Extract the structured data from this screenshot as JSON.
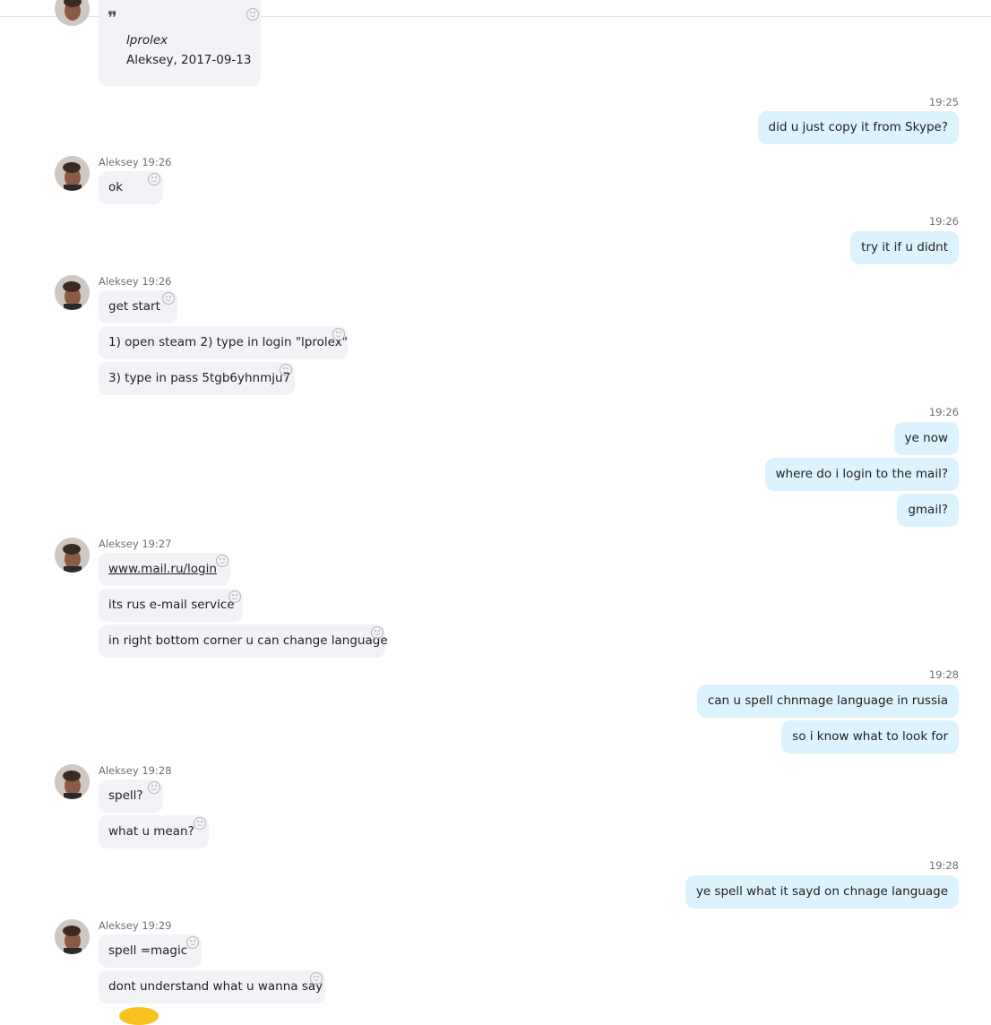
{
  "quote": {
    "author": "lprolex",
    "source": "Aleksey, 2017-09-13"
  },
  "messages": {
    "t1": "19:25",
    "m1": "did u just copy it from Skype?",
    "g1": {
      "sender": "Aleksey",
      "time": "19:26"
    },
    "m2": "ok",
    "t2": "19:26",
    "m3": "try it if u didnt",
    "g2": {
      "sender": "Aleksey",
      "time": "19:26"
    },
    "m4": "get start",
    "m5": "1) open steam 2) type in login \"lprolex\"",
    "m6": "3) type in pass 5tgb6yhnmju7",
    "t3": "19:26",
    "m7": "ye now",
    "m8": "where do i login to the mail?",
    "m9": "gmail?",
    "g3": {
      "sender": "Aleksey",
      "time": "19:27"
    },
    "m10": "www.mail.ru/login",
    "m11": "its rus e-mail service",
    "m12": "in right bottom corner u can change language",
    "t4": "19:28",
    "m13": "can u spell chnmage language in russia",
    "m14": "so i know what to look for",
    "g4": {
      "sender": "Aleksey",
      "time": "19:28"
    },
    "m15": "spell?",
    "m16": "what u mean?",
    "t5": "19:28",
    "m17": "ye spell what it sayd on chnage language",
    "g5": {
      "sender": "Aleksey",
      "time": "19:29"
    },
    "m18": "spell =magic",
    "m19": "dont understand what u wanna say"
  },
  "icons": {
    "quote": "quote-icon",
    "reaction": "reaction-smiley-icon",
    "avatar": "contact-avatar"
  },
  "colors": {
    "incoming_bubble": "#f1f3f6",
    "outgoing_bubble": "#dcf2fc",
    "meta_text": "#707070"
  }
}
